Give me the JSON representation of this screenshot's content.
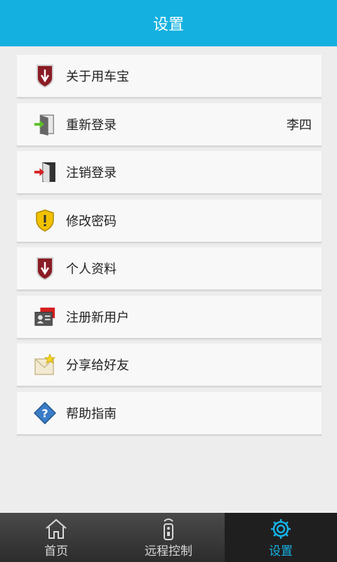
{
  "header": {
    "title": "设置"
  },
  "menu": [
    {
      "label": "关于用车宝",
      "icon": "shield-logo-icon",
      "value": ""
    },
    {
      "label": "重新登录",
      "icon": "login-door-icon",
      "value": "李四"
    },
    {
      "label": "注销登录",
      "icon": "logout-door-icon",
      "value": ""
    },
    {
      "label": "修改密码",
      "icon": "warning-shield-icon",
      "value": ""
    },
    {
      "label": "个人资料",
      "icon": "shield-logo-icon",
      "value": ""
    },
    {
      "label": "注册新用户",
      "icon": "id-card-icon",
      "value": ""
    },
    {
      "label": "分享给好友",
      "icon": "envelope-star-icon",
      "value": ""
    },
    {
      "label": "帮助指南",
      "icon": "help-diamond-icon",
      "value": ""
    }
  ],
  "tabs": [
    {
      "label": "首页",
      "icon": "home-icon",
      "active": false
    },
    {
      "label": "远程控制",
      "icon": "remote-icon",
      "active": false
    },
    {
      "label": "设置",
      "icon": "gear-icon",
      "active": true
    }
  ],
  "colors": {
    "header": "#14b1e0",
    "accent": "#16b2e6",
    "tabbar": "#2c2c2c"
  }
}
